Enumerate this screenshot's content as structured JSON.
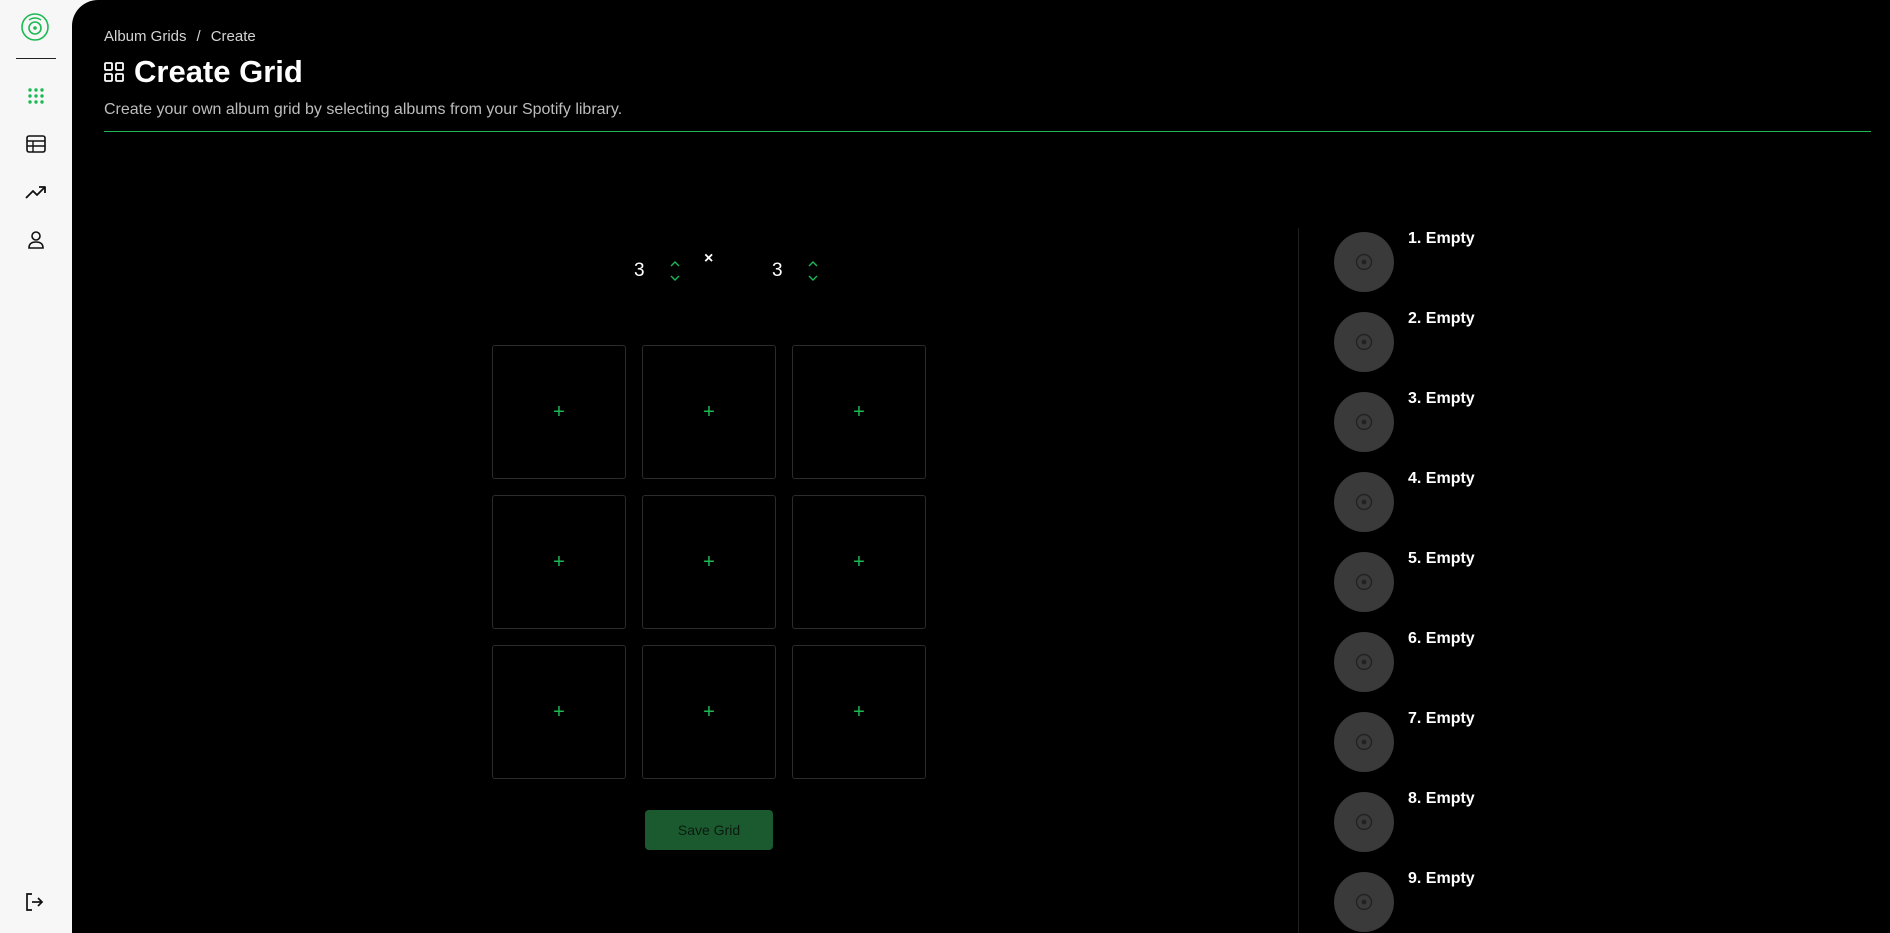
{
  "breadcrumb": {
    "root": "Album Grids",
    "separator": "/",
    "current": "Create"
  },
  "header": {
    "title": "Create Grid",
    "subtitle": "Create your own album grid by selecting albums from your Spotify library."
  },
  "dimensions": {
    "rows": "3",
    "times": "×",
    "columns": "3"
  },
  "grid": {
    "cells": [
      "+",
      "+",
      "+",
      "+",
      "+",
      "+",
      "+",
      "+",
      "+"
    ]
  },
  "save_button": "Save Grid",
  "album_list": [
    {
      "label": "1. Empty"
    },
    {
      "label": "2. Empty"
    },
    {
      "label": "3. Empty"
    },
    {
      "label": "4. Empty"
    },
    {
      "label": "5. Empty"
    },
    {
      "label": "6. Empty"
    },
    {
      "label": "7. Empty"
    },
    {
      "label": "8. Empty"
    },
    {
      "label": "9. Empty"
    }
  ],
  "sidebar": {
    "icons": [
      "grid-icon",
      "table-icon",
      "trending-icon",
      "user-icon"
    ],
    "logout_icon": "logout-icon"
  },
  "colors": {
    "accent": "#1db954",
    "background": "#000000",
    "sidebar": "#f7f7f7",
    "save_button": "#1a5a2e"
  }
}
